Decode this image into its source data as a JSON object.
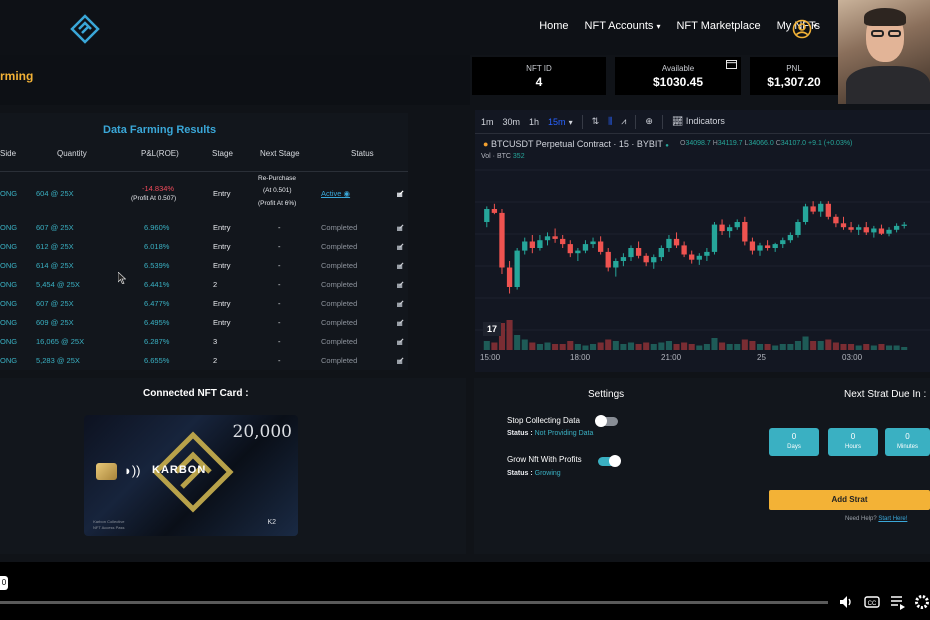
{
  "nav": {
    "links": [
      "Home",
      "NFT Accounts",
      "NFT Marketplace",
      "My NFTs"
    ]
  },
  "page": {
    "heading": "rming"
  },
  "stats": [
    {
      "label": "NFT ID",
      "value": "4"
    },
    {
      "label": "Available",
      "value": "$1030.45"
    },
    {
      "label": "PNL",
      "value": "$1,307.20"
    }
  ],
  "results": {
    "title": "Data Farming Results",
    "headers": [
      "Side",
      "Quantity",
      "P&L(ROE)",
      "Stage",
      "Next Stage",
      "Status"
    ],
    "first_row": {
      "side": "ONG",
      "quantity": "604 @ 25X",
      "pnl": "-14.834%",
      "pnl_sub": "(Profit At 0.507)",
      "stage": "Entry",
      "next_line1": "Re-Purchase",
      "next_line2": "(At 0.501)",
      "next_line3": "(Profit At 6%)",
      "status": "Active"
    },
    "rows": [
      {
        "side": "ONG",
        "quantity": "607 @ 25X",
        "pnl": "6.960%",
        "stage": "Entry",
        "next": "-",
        "status": "Completed"
      },
      {
        "side": "ONG",
        "quantity": "612 @ 25X",
        "pnl": "6.018%",
        "stage": "Entry",
        "next": "-",
        "status": "Completed"
      },
      {
        "side": "ONG",
        "quantity": "614 @ 25X",
        "pnl": "6.539%",
        "stage": "Entry",
        "next": "-",
        "status": "Completed"
      },
      {
        "side": "ONG",
        "quantity": "5,454 @ 25X",
        "pnl": "6.441%",
        "stage": "2",
        "next": "-",
        "status": "Completed"
      },
      {
        "side": "ONG",
        "quantity": "607 @ 25X",
        "pnl": "6.477%",
        "stage": "Entry",
        "next": "-",
        "status": "Completed"
      },
      {
        "side": "ONG",
        "quantity": "609 @ 25X",
        "pnl": "6.495%",
        "stage": "Entry",
        "next": "-",
        "status": "Completed"
      },
      {
        "side": "ONG",
        "quantity": "16,065 @ 25X",
        "pnl": "6.287%",
        "stage": "3",
        "next": "-",
        "status": "Completed"
      },
      {
        "side": "ONG",
        "quantity": "5,283 @ 25X",
        "pnl": "6.655%",
        "stage": "2",
        "next": "-",
        "status": "Completed"
      }
    ]
  },
  "chart": {
    "toolbar": {
      "intervals": [
        "1m",
        "30m",
        "1h",
        "15m"
      ],
      "indicators_label": "Indicators"
    },
    "symbol_title": "BTCUSDT Perpetual Contract · 15 · BYBIT",
    "ohlc": {
      "o": "34098.7",
      "h": "34119.7",
      "l": "34066.0",
      "c": "34107.0",
      "chg": "+9.1 (+0.03%)"
    },
    "volume_label": "Vol · BTC",
    "volume_value": "352",
    "time_labels": [
      "15:00",
      "18:00",
      "21:00",
      "25",
      "03:00"
    ],
    "up_color": "#26a69a",
    "down_color": "#ef5350"
  },
  "chart_data": {
    "type": "candlestick",
    "title": "BTCUSDT Perpetual Contract · 15 · BYBIT",
    "x_labels": [
      "15:00",
      "18:00",
      "21:00",
      "25",
      "03:00"
    ],
    "candles": [
      [
        0.6,
        0.72,
        0.56,
        0.7
      ],
      [
        0.7,
        0.74,
        0.66,
        0.67
      ],
      [
        0.67,
        0.7,
        0.2,
        0.25
      ],
      [
        0.25,
        0.3,
        0.05,
        0.1
      ],
      [
        0.1,
        0.4,
        0.08,
        0.38
      ],
      [
        0.38,
        0.48,
        0.35,
        0.45
      ],
      [
        0.45,
        0.5,
        0.36,
        0.4
      ],
      [
        0.4,
        0.5,
        0.38,
        0.46
      ],
      [
        0.46,
        0.52,
        0.42,
        0.49
      ],
      [
        0.49,
        0.55,
        0.44,
        0.47
      ],
      [
        0.47,
        0.5,
        0.4,
        0.43
      ],
      [
        0.43,
        0.46,
        0.33,
        0.36
      ],
      [
        0.36,
        0.4,
        0.3,
        0.38
      ],
      [
        0.38,
        0.46,
        0.36,
        0.43
      ],
      [
        0.43,
        0.48,
        0.4,
        0.45
      ],
      [
        0.45,
        0.49,
        0.35,
        0.37
      ],
      [
        0.37,
        0.4,
        0.22,
        0.25
      ],
      [
        0.25,
        0.32,
        0.18,
        0.3
      ],
      [
        0.3,
        0.36,
        0.26,
        0.33
      ],
      [
        0.33,
        0.42,
        0.3,
        0.4
      ],
      [
        0.4,
        0.45,
        0.32,
        0.34
      ],
      [
        0.34,
        0.36,
        0.26,
        0.29
      ],
      [
        0.29,
        0.35,
        0.24,
        0.33
      ],
      [
        0.33,
        0.42,
        0.3,
        0.4
      ],
      [
        0.4,
        0.5,
        0.37,
        0.47
      ],
      [
        0.47,
        0.52,
        0.4,
        0.42
      ],
      [
        0.42,
        0.45,
        0.33,
        0.35
      ],
      [
        0.35,
        0.38,
        0.28,
        0.31
      ],
      [
        0.31,
        0.36,
        0.27,
        0.34
      ],
      [
        0.34,
        0.4,
        0.3,
        0.37
      ],
      [
        0.37,
        0.6,
        0.35,
        0.58
      ],
      [
        0.58,
        0.62,
        0.5,
        0.53
      ],
      [
        0.53,
        0.58,
        0.48,
        0.56
      ],
      [
        0.56,
        0.62,
        0.54,
        0.6
      ],
      [
        0.6,
        0.64,
        0.42,
        0.45
      ],
      [
        0.45,
        0.48,
        0.35,
        0.38
      ],
      [
        0.38,
        0.44,
        0.34,
        0.42
      ],
      [
        0.42,
        0.46,
        0.38,
        0.4
      ],
      [
        0.4,
        0.44,
        0.37,
        0.43
      ],
      [
        0.43,
        0.48,
        0.4,
        0.46
      ],
      [
        0.46,
        0.52,
        0.44,
        0.5
      ],
      [
        0.5,
        0.62,
        0.48,
        0.6
      ],
      [
        0.6,
        0.74,
        0.58,
        0.72
      ],
      [
        0.72,
        0.76,
        0.66,
        0.68
      ],
      [
        0.68,
        0.76,
        0.64,
        0.74
      ],
      [
        0.74,
        0.76,
        0.62,
        0.64
      ],
      [
        0.64,
        0.66,
        0.56,
        0.59
      ],
      [
        0.59,
        0.64,
        0.54,
        0.56
      ],
      [
        0.56,
        0.6,
        0.52,
        0.54
      ],
      [
        0.54,
        0.58,
        0.5,
        0.56
      ],
      [
        0.56,
        0.6,
        0.5,
        0.52
      ],
      [
        0.52,
        0.57,
        0.48,
        0.55
      ],
      [
        0.55,
        0.58,
        0.5,
        0.51
      ],
      [
        0.51,
        0.56,
        0.49,
        0.54
      ],
      [
        0.54,
        0.59,
        0.52,
        0.57
      ],
      [
        0.57,
        0.6,
        0.55,
        0.58
      ]
    ],
    "volumes": [
      0.3,
      0.25,
      0.9,
      1.0,
      0.5,
      0.35,
      0.25,
      0.2,
      0.25,
      0.2,
      0.2,
      0.3,
      0.2,
      0.15,
      0.2,
      0.25,
      0.35,
      0.3,
      0.2,
      0.25,
      0.2,
      0.25,
      0.2,
      0.25,
      0.3,
      0.2,
      0.25,
      0.2,
      0.15,
      0.2,
      0.4,
      0.25,
      0.2,
      0.2,
      0.35,
      0.3,
      0.2,
      0.2,
      0.15,
      0.2,
      0.2,
      0.3,
      0.45,
      0.3,
      0.3,
      0.35,
      0.25,
      0.2,
      0.2,
      0.15,
      0.2,
      0.15,
      0.2,
      0.15,
      0.15,
      0.1
    ]
  },
  "card_panel": {
    "title": "Connected NFT Card :",
    "card_value": "20,000",
    "brand": "KARBON",
    "fine_line1": "Karbon Collective",
    "fine_line2": "NFT Access Pass",
    "code": "K2"
  },
  "settings": {
    "title": "Settings",
    "stop_label": "Stop Collecting Data",
    "stop_status_prefix": "Status :",
    "stop_status_value": "Not Providing Data",
    "grow_label": "Grow Nft With Profits",
    "grow_status_prefix": "Status :",
    "grow_status_value": "Growing",
    "stop_on": false,
    "grow_on": true
  },
  "strat": {
    "title": "Next Strat Due In :",
    "boxes": [
      {
        "value": "0",
        "unit": "Days"
      },
      {
        "value": "0",
        "unit": "Hours"
      },
      {
        "value": "0",
        "unit": "Minutes"
      }
    ],
    "add_label": "Add Strat",
    "help_prefix": "Need Help?",
    "help_link": "Start Here!"
  },
  "player": {
    "time_badge": "0",
    "progress": 0.0
  }
}
